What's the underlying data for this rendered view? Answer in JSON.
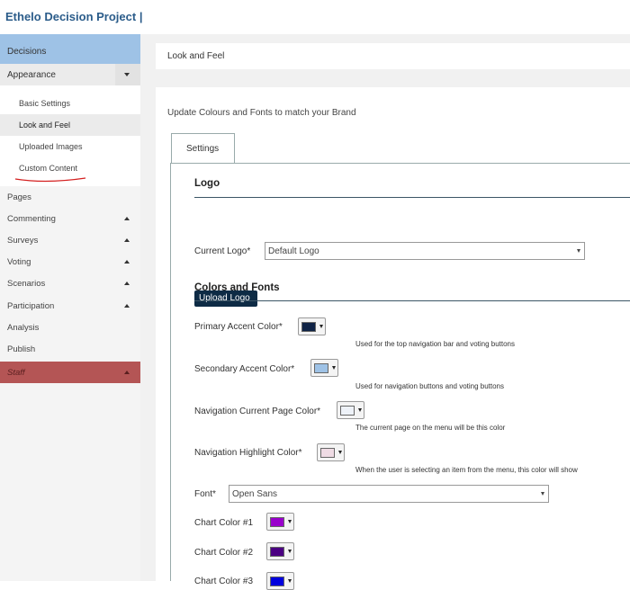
{
  "app": {
    "title": "Ethelo Decision Project |"
  },
  "sidebar": {
    "decisions": "Decisions",
    "appearance": "Appearance",
    "sub_items": [
      {
        "label": "Basic Settings"
      },
      {
        "label": "Look and Feel"
      },
      {
        "label": "Uploaded Images"
      },
      {
        "label": "Custom Content"
      }
    ],
    "items": [
      {
        "label": "Pages",
        "caret": false
      },
      {
        "label": "Commenting",
        "caret": true
      },
      {
        "label": "Surveys",
        "caret": true
      },
      {
        "label": "Voting",
        "caret": true
      },
      {
        "label": "Scenarios",
        "caret": true
      },
      {
        "label": "Participation",
        "caret": true
      },
      {
        "label": "Analysis",
        "caret": false
      },
      {
        "label": "Publish",
        "caret": false
      }
    ],
    "staff": "Staff"
  },
  "breadcrumb": "Look and Feel",
  "intro": "Update Colours and Fonts to match your Brand",
  "tabs": [
    {
      "label": "Settings"
    }
  ],
  "logo_section": {
    "heading": "Logo",
    "upload_button": "Upload Logo",
    "current_logo_label": "Current Logo*",
    "current_logo_value": "Default Logo"
  },
  "colors_section": {
    "heading": "Colors and Fonts",
    "primary": {
      "label": "Primary Accent Color*",
      "help": "Used for the top navigation bar and voting buttons",
      "color": "#0e2245"
    },
    "secondary": {
      "label": "Secondary Accent Color*",
      "help": "Used for navigation buttons and voting buttons",
      "color": "#9ec2e6"
    },
    "nav_current": {
      "label": "Navigation Current Page Color*",
      "help": "The current page on the menu will be this color",
      "color": "#eef2f8"
    },
    "nav_highlight": {
      "label": "Navigation Highlight Color*",
      "help": "When the user is selecting an item from the menu, this color will show",
      "color": "#efdbe4"
    },
    "font": {
      "label": "Font*",
      "value": "Open Sans"
    },
    "chart1": {
      "label": "Chart Color #1",
      "color": "#9900cc"
    },
    "chart2": {
      "label": "Chart Color #2",
      "color": "#4b0082"
    },
    "chart3": {
      "label": "Chart Color #3",
      "color": "#0000dd"
    }
  }
}
